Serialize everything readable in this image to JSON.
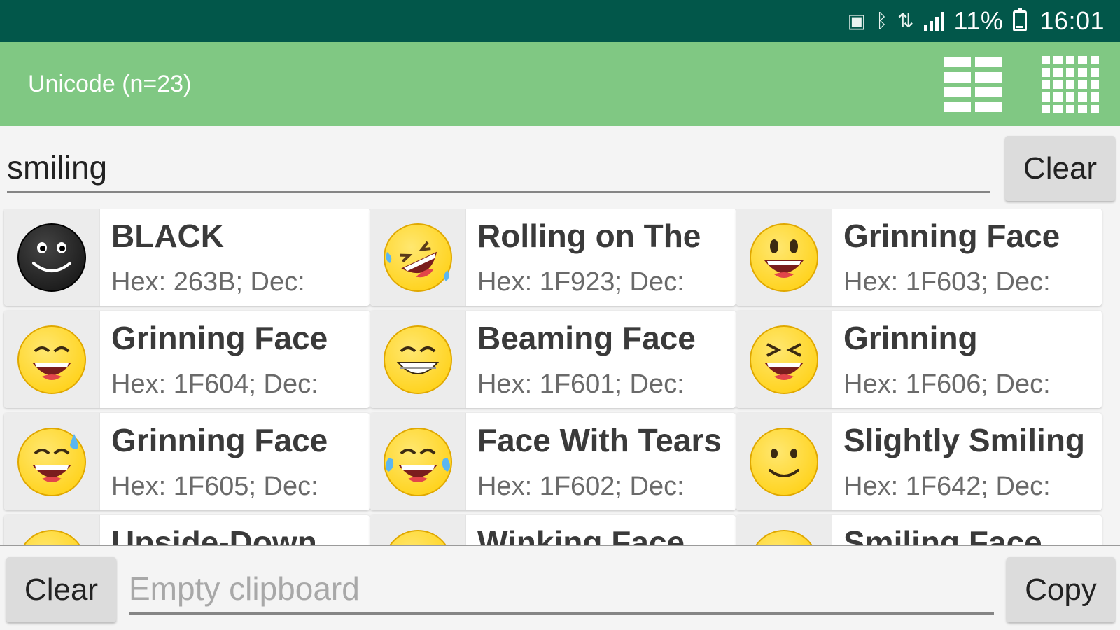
{
  "status_bar": {
    "battery_percent": "11%",
    "time": "16:01",
    "icons": [
      "sim-icon",
      "bluetooth-icon",
      "data-icon",
      "signal-icon",
      "battery-icon"
    ]
  },
  "app_bar": {
    "title": "Unicode (n=23)",
    "list_view_icon": "list-view-icon",
    "grid_view_icon": "grid-view-icon"
  },
  "search": {
    "value": "smiling",
    "clear_label": "Clear"
  },
  "results": [
    {
      "name": "BLACK",
      "code": "Hex: 263B; Dec:",
      "emoji": "black-smiling-face"
    },
    {
      "name": "Rolling on The",
      "code": "Hex: 1F923; Dec:",
      "emoji": "rolling-on-floor-laughing"
    },
    {
      "name": "Grinning Face",
      "code": "Hex: 1F603; Dec:",
      "emoji": "grinning-face-big-eyes"
    },
    {
      "name": "Grinning Face",
      "code": "Hex: 1F604; Dec:",
      "emoji": "grinning-face-smiling-eyes"
    },
    {
      "name": "Beaming Face",
      "code": "Hex: 1F601; Dec:",
      "emoji": "beaming-face"
    },
    {
      "name": "Grinning",
      "code": "Hex: 1F606; Dec:",
      "emoji": "grinning-squinting-face"
    },
    {
      "name": "Grinning Face",
      "code": "Hex: 1F605; Dec:",
      "emoji": "grinning-face-sweat"
    },
    {
      "name": "Face With Tears",
      "code": "Hex: 1F602; Dec:",
      "emoji": "face-with-tears-of-joy"
    },
    {
      "name": "Slightly Smiling",
      "code": "Hex: 1F642; Dec:",
      "emoji": "slightly-smiling-face"
    },
    {
      "name": "Upside-Down",
      "code": "",
      "emoji": "upside-down-face"
    },
    {
      "name": "Winking Face",
      "code": "",
      "emoji": "winking-face"
    },
    {
      "name": "Smiling Face",
      "code": "",
      "emoji": "smiling-face"
    }
  ],
  "clipboard": {
    "clear_label": "Clear",
    "placeholder": "Empty clipboard",
    "copy_label": "Copy"
  },
  "colors": {
    "status_bar": "#02574a",
    "app_bar": "#80c883",
    "emoji_yellow": "#ffd21a",
    "emoji_black": "#1a1a1a"
  }
}
